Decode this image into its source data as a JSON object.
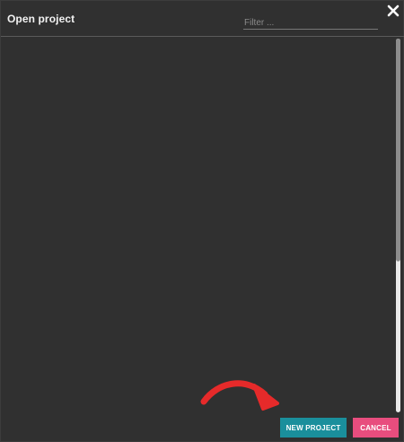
{
  "dialog": {
    "title": "Open project",
    "filter_placeholder": "Filter ...",
    "filter_value": ""
  },
  "buttons": {
    "new_project": "NEW PROJECT",
    "cancel": "CANCEL"
  },
  "icons": {
    "close": "close-icon",
    "arrow": "arrow-annotation-icon"
  },
  "colors": {
    "background": "#303030",
    "new_project_button": "#1a8f9c",
    "cancel_button": "#e84d7e",
    "arrow": "#e62a2a"
  }
}
